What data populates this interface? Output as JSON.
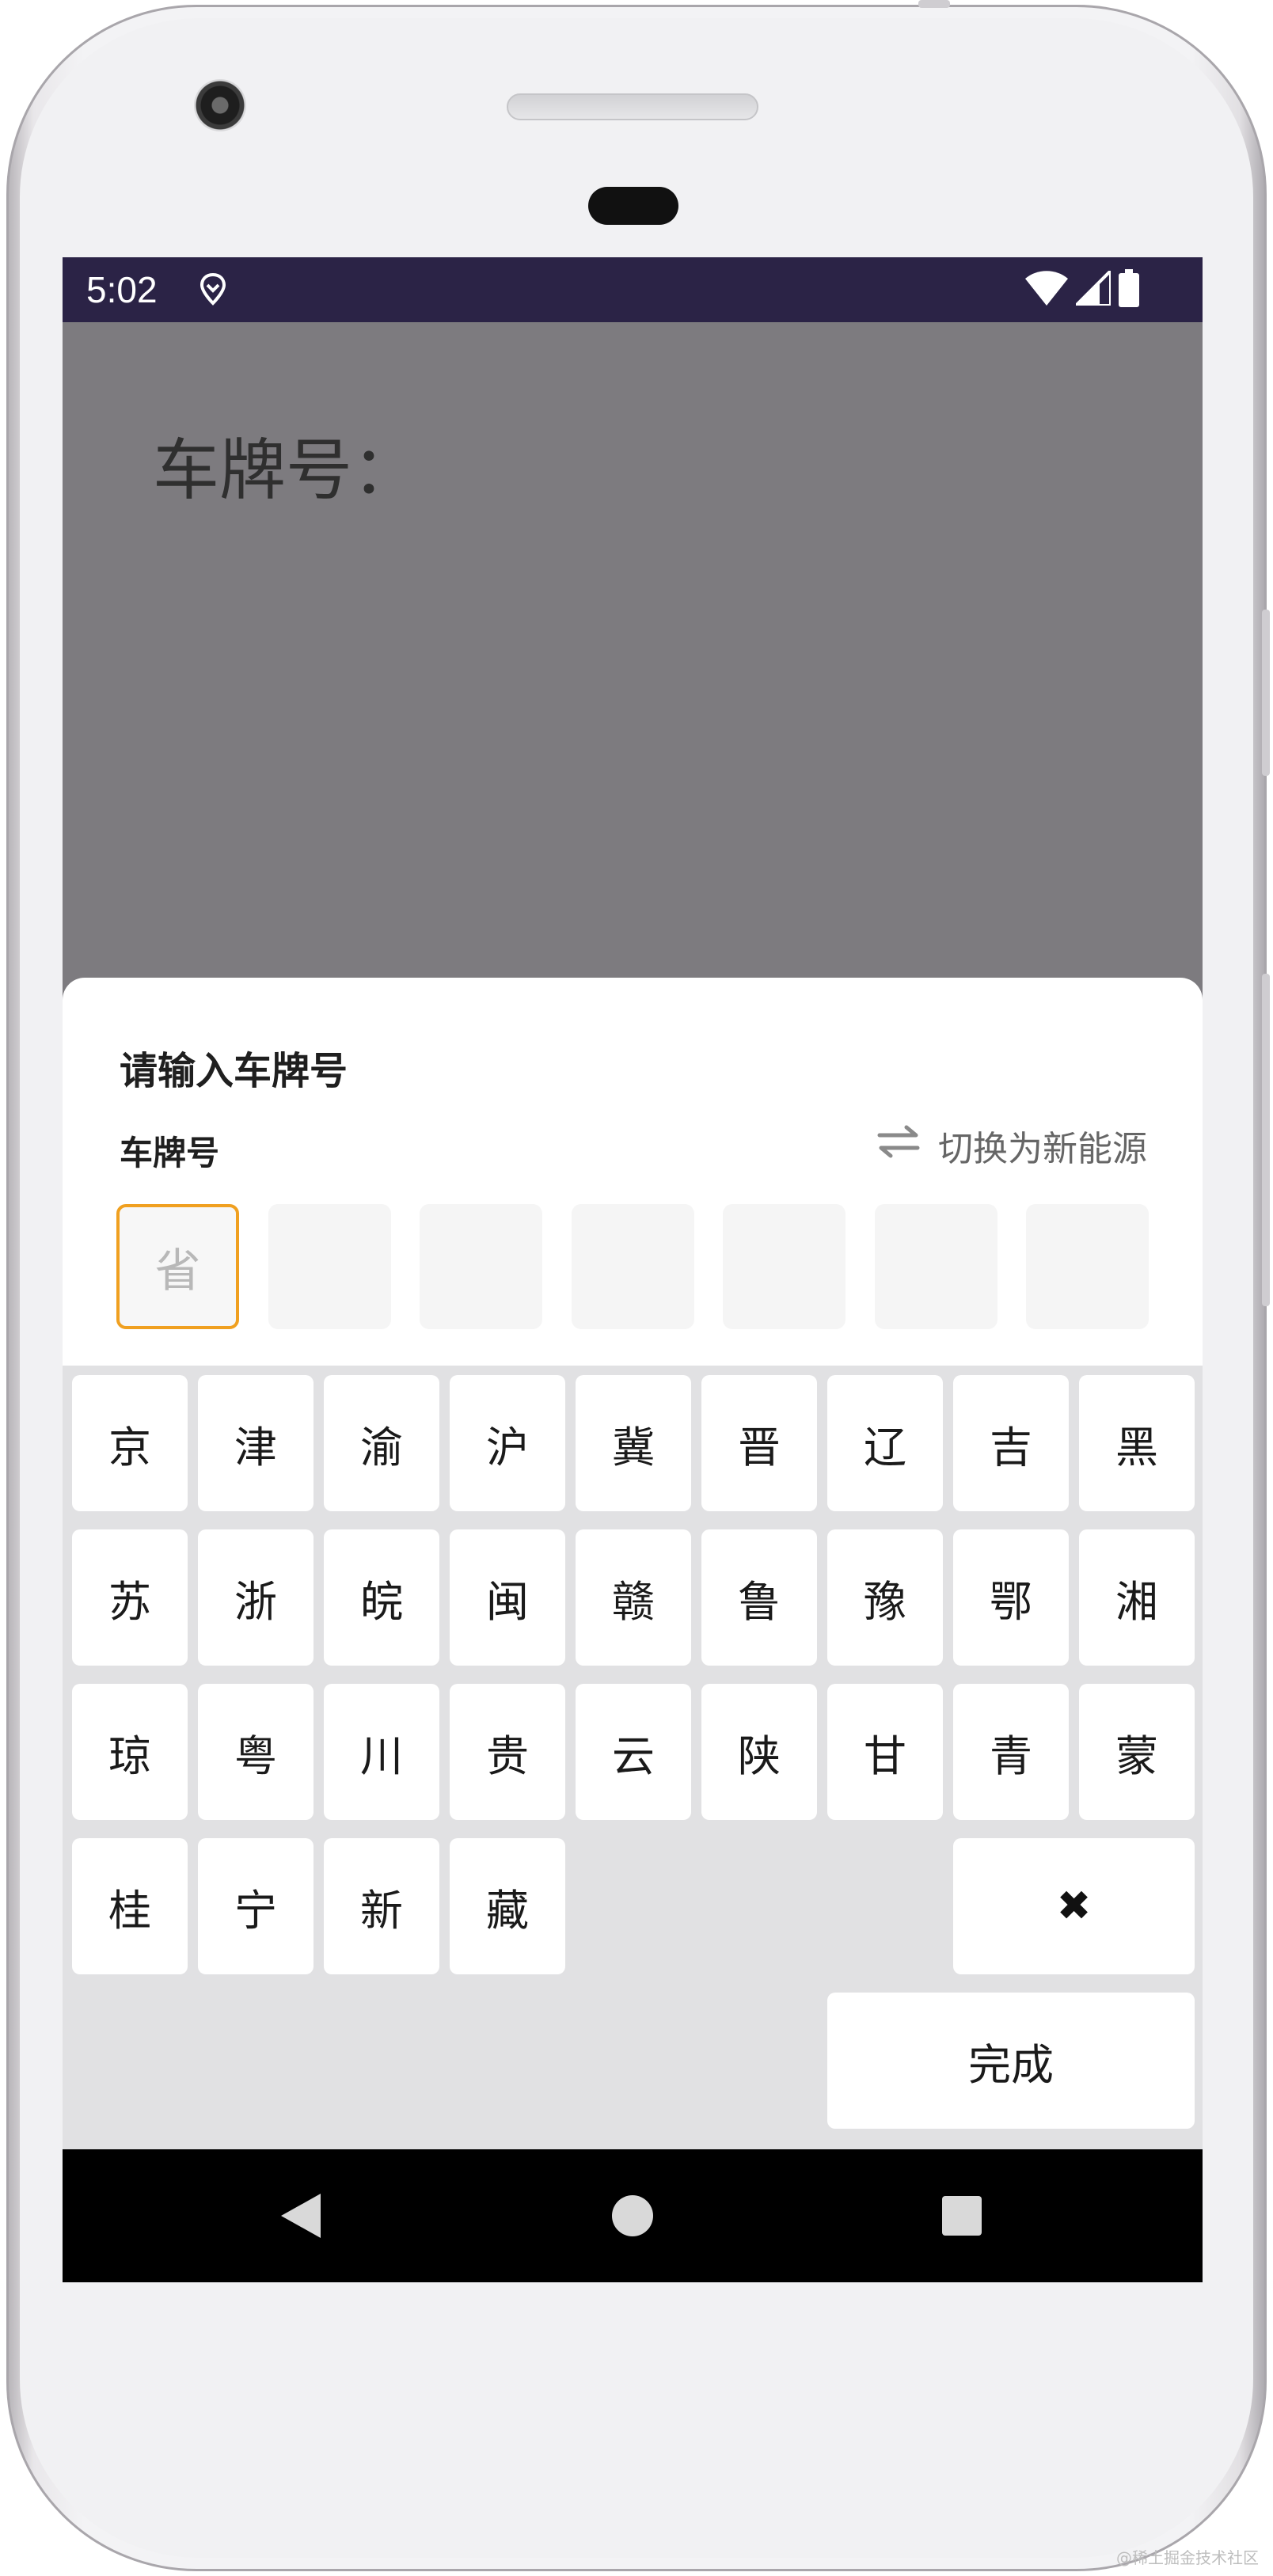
{
  "status_bar": {
    "time": "5:02"
  },
  "app": {
    "heading": "车牌号："
  },
  "sheet": {
    "title": "请输入车牌号",
    "plate_label": "车牌号",
    "switch_label": "切换为新能源",
    "plate_slots": [
      "省",
      "",
      "",
      "",
      "",
      "",
      ""
    ]
  },
  "keyboard": {
    "rows": [
      [
        "京",
        "津",
        "渝",
        "沪",
        "冀",
        "晋",
        "辽",
        "吉",
        "黑"
      ],
      [
        "苏",
        "浙",
        "皖",
        "闽",
        "赣",
        "鲁",
        "豫",
        "鄂",
        "湘"
      ],
      [
        "琼",
        "粤",
        "川",
        "贵",
        "云",
        "陕",
        "甘",
        "青",
        "蒙"
      ],
      [
        "桂",
        "宁",
        "新",
        "藏"
      ]
    ],
    "delete_glyph": "✖",
    "done_label": "完成"
  },
  "colors": {
    "status_bar": "#2b2346",
    "scrim": "#7d7b7f",
    "active_slot_border": "#f0a020",
    "keyboard_bg": "#e1e1e3"
  },
  "watermark": "@稀土掘金技术社区"
}
